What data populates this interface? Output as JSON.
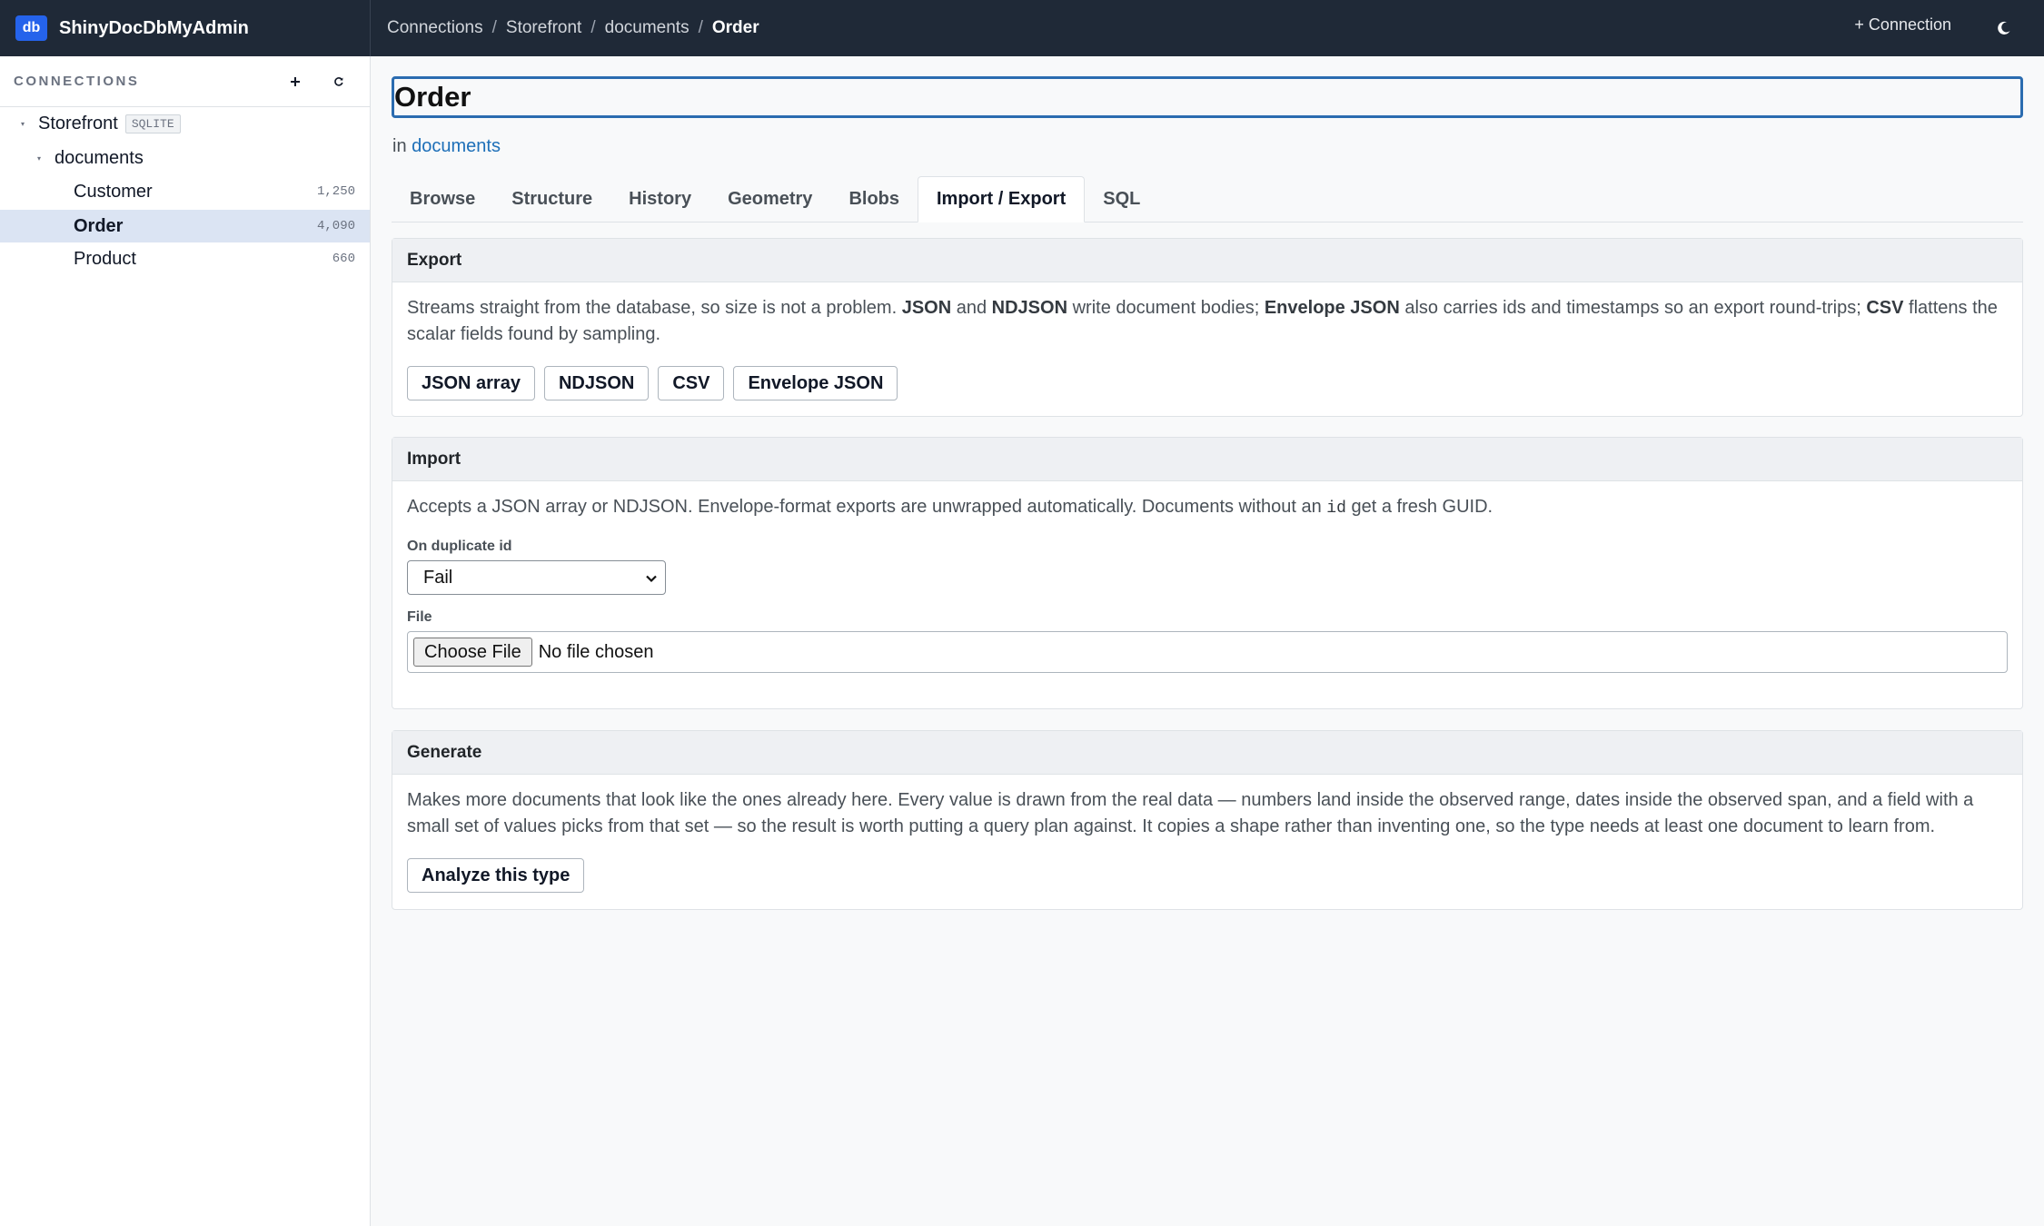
{
  "app": {
    "badge": "db",
    "name": "ShinyDocDbMyAdmin"
  },
  "breadcrumb": {
    "items": [
      "Connections",
      "Storefront",
      "documents",
      "Order"
    ],
    "separator": "/"
  },
  "top_actions": {
    "new_connection": "+ Connection",
    "theme_icon": "moon-icon"
  },
  "sidebar": {
    "title": "CONNECTIONS",
    "add_icon": "plus-icon",
    "refresh_icon": "refresh-icon",
    "connection": {
      "label": "Storefront",
      "badge": "SQLITE"
    },
    "database": {
      "label": "documents"
    },
    "types": [
      {
        "label": "Customer",
        "count": "1,250"
      },
      {
        "label": "Order",
        "count": "4,090",
        "active": true
      },
      {
        "label": "Product",
        "count": "660"
      }
    ]
  },
  "main": {
    "title": "Order",
    "in_prefix": "in",
    "in_link": "documents",
    "tabs": [
      "Browse",
      "Structure",
      "History",
      "Geometry",
      "Blobs",
      "Import / Export",
      "SQL"
    ],
    "active_tab": "Import / Export"
  },
  "export": {
    "heading": "Export",
    "desc": {
      "t1": "Streams straight from the database, so size is not a problem.",
      "b1": "JSON",
      "t2": "and",
      "b2": "NDJSON",
      "t3": "write document bodies;",
      "b3": "Envelope JSON",
      "t4": "also carries ids and timestamps so an export round-trips;",
      "b4": "CSV",
      "t5": "flattens the scalar fields found by sampling."
    },
    "buttons": [
      "JSON array",
      "NDJSON",
      "CSV",
      "Envelope JSON"
    ]
  },
  "import": {
    "heading": "Import",
    "desc": {
      "t1": "Accepts a JSON array or NDJSON. Envelope-format exports are unwrapped automatically. Documents without an",
      "code": "id",
      "t2": "get a fresh GUID."
    },
    "duplicate_label": "On duplicate id",
    "duplicate_value": "Fail",
    "file_label": "File",
    "file_button": "Choose File",
    "file_status": "No file chosen"
  },
  "generate": {
    "heading": "Generate",
    "desc": "Makes more documents that look like the ones already here. Every value is drawn from the real data — numbers land inside the observed range, dates inside the observed span, and a field with a small set of values picks from that set — so the result is worth putting a query plan against. It copies a shape rather than inventing one, so the type needs at least one document to learn from.",
    "button": "Analyze this type"
  },
  "colors": {
    "topbar": "#1f2937",
    "accent": "#2563eb",
    "active_row": "#dbe4f3",
    "link": "#1d6fb8"
  }
}
